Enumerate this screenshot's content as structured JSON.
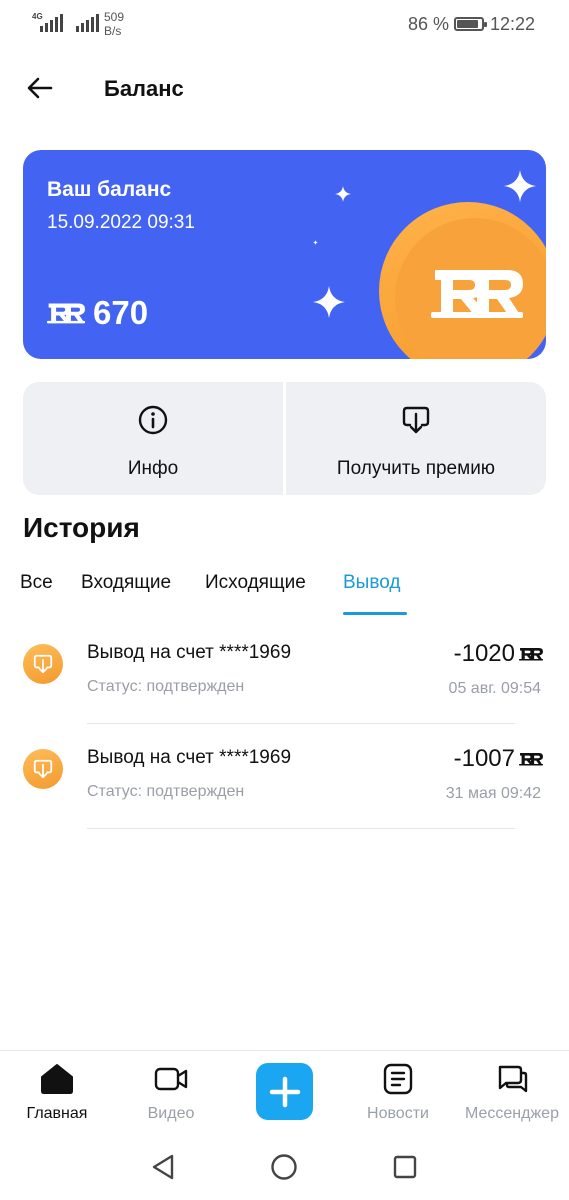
{
  "status_bar": {
    "network_label": "4G",
    "net_speed_value": "509",
    "net_speed_unit": "B/s",
    "battery_percent": "86 %",
    "battery_level": 0.86,
    "time": "12:22"
  },
  "header": {
    "title": "Баланс",
    "back_icon": "arrow-left-icon"
  },
  "balance": {
    "title": "Ваш баланс",
    "date": "15.09.2022 09:31",
    "amount": "670",
    "currency_icon": "rr-currency-icon",
    "card_color": "#4363f2",
    "coin_color": "#f7a23a"
  },
  "actions": [
    {
      "label": "Инфо",
      "icon": "info-circle-icon"
    },
    {
      "label": "Получить премию",
      "icon": "download-bubble-icon"
    }
  ],
  "history": {
    "title": "История",
    "tabs": [
      {
        "label": "Все",
        "active": false
      },
      {
        "label": "Входящие",
        "active": false
      },
      {
        "label": "Исходящие",
        "active": false
      },
      {
        "label": "Вывод",
        "active": true
      }
    ],
    "transactions": [
      {
        "title": "Вывод на счет ****1969",
        "status": "Статус: подтвержден",
        "amount": "-1020",
        "date": "05 авг. 09:54"
      },
      {
        "title": "Вывод на счет ****1969",
        "status": "Статус: подтвержден",
        "amount": "-1007",
        "date": "31 мая 09:42"
      }
    ],
    "accent_color": "#1a9bd8"
  },
  "bottom_nav": {
    "items": [
      {
        "label": "Главная",
        "icon": "home-icon",
        "active": true
      },
      {
        "label": "Видео",
        "icon": "video-camera-icon",
        "active": false
      },
      {
        "label": "Новости",
        "icon": "news-icon",
        "active": false
      },
      {
        "label": "Мессенджер",
        "icon": "chat-bubbles-icon",
        "active": false
      }
    ],
    "add_icon": "plus-icon",
    "add_color": "#1aa6f0"
  },
  "system_nav": {
    "back_icon": "triangle-back-icon",
    "home_icon": "circle-home-icon",
    "recents_icon": "square-recents-icon"
  }
}
